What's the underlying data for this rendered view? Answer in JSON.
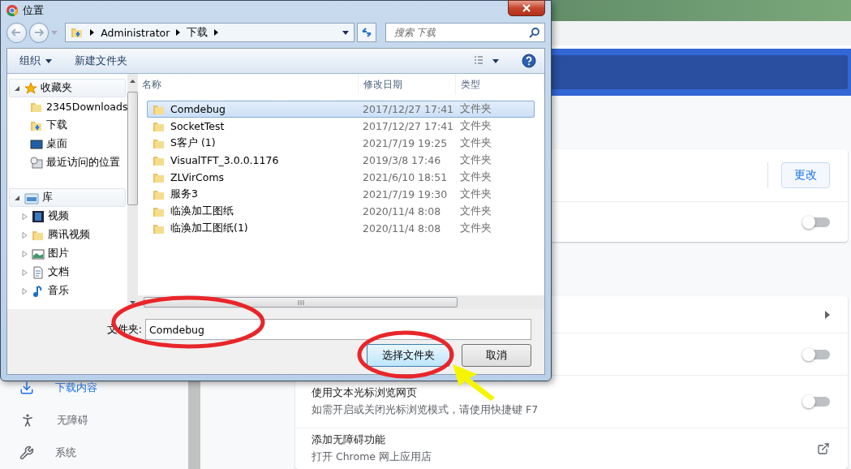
{
  "browser": {
    "sidebar": [
      {
        "kind": "download",
        "label": "下载内容",
        "selected": true
      },
      {
        "kind": "accessibility",
        "label": "无障碍",
        "selected": false
      },
      {
        "kind": "wrench",
        "label": "系统",
        "selected": false
      }
    ],
    "cards": [
      {
        "rows": [
          {
            "kind": "button",
            "button": "更改"
          },
          {
            "kind": "toggle",
            "on": false
          }
        ]
      },
      {
        "rows": [
          {
            "kind": "arrow"
          },
          {
            "kind": "toggle",
            "on": false
          },
          {
            "kind": "toggle",
            "on": false,
            "title": "使用文本光标浏览网页",
            "subtitle": "如需开启或关闭光标浏览模式，请使用快捷键 F7"
          },
          {
            "kind": "external",
            "title": "添加无障碍功能",
            "subtitle": "打开 Chrome 网上应用店"
          }
        ]
      }
    ]
  },
  "dialog": {
    "title": "位置",
    "breadcrumb": [
      "Administrator",
      "下载"
    ],
    "search": {
      "placeholder": "搜索 下载"
    },
    "toolbar": {
      "organize": "组织",
      "new_folder": "新建文件夹"
    },
    "nav": [
      {
        "kind": "star",
        "label": "收藏夹",
        "expanded": true,
        "children": [
          {
            "kind": "folder",
            "label": "2345Downloads"
          },
          {
            "kind": "download-folder",
            "label": "下载"
          },
          {
            "kind": "desktop",
            "label": "桌面"
          },
          {
            "kind": "recent",
            "label": "最近访问的位置"
          }
        ]
      },
      {
        "kind": "library",
        "label": "库",
        "expanded": true,
        "children": [
          {
            "kind": "video",
            "label": "视频",
            "expanded": false
          },
          {
            "kind": "folder",
            "label": "腾讯视频",
            "expanded": false
          },
          {
            "kind": "image",
            "label": "图片",
            "expanded": false
          },
          {
            "kind": "doc",
            "label": "文档",
            "expanded": false
          },
          {
            "kind": "music",
            "label": "音乐",
            "expanded": false
          }
        ]
      }
    ],
    "columns": [
      "名称",
      "修改日期",
      "类型"
    ],
    "rows": [
      {
        "name": "Comdebug",
        "date": "2017/12/27 17:41",
        "type": "文件夹",
        "selected": true
      },
      {
        "name": "SocketTest",
        "date": "2017/12/27 17:41",
        "type": "文件夹",
        "selected": false
      },
      {
        "name": "S客户 (1)",
        "date": "2021/7/19 19:25",
        "type": "文件夹",
        "selected": false
      },
      {
        "name": "VisualTFT_3.0.0.1176",
        "date": "2019/3/8 17:46",
        "type": "文件夹",
        "selected": false
      },
      {
        "name": "ZLVirComs",
        "date": "2021/6/10 18:51",
        "type": "文件夹",
        "selected": false
      },
      {
        "name": "服务3",
        "date": "2021/7/19 19:30",
        "type": "文件夹",
        "selected": false
      },
      {
        "name": "临涣加工图纸",
        "date": "2020/11/4 8:08",
        "type": "文件夹",
        "selected": false
      },
      {
        "name": "临涣加工图纸(1)",
        "date": "2020/11/4 8:08",
        "type": "文件夹",
        "selected": false
      }
    ],
    "folder_label": "文件夹:",
    "folder_value": "Comdebug",
    "buttons": {
      "ok": "选择文件夹",
      "cancel": "取消"
    }
  }
}
